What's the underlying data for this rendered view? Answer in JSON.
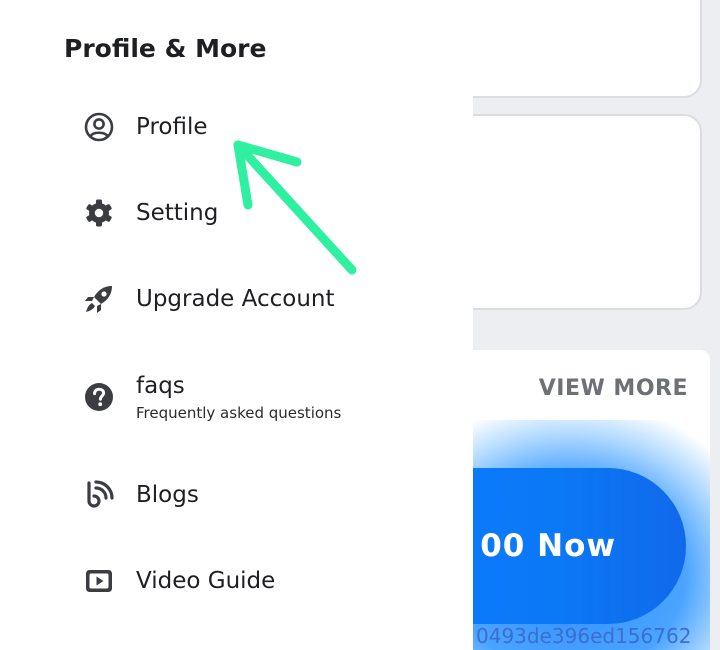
{
  "drawer": {
    "title": "Profile & More",
    "items": [
      {
        "label": "Profile",
        "icon": "user-circle-icon"
      },
      {
        "label": "Setting",
        "icon": "gear-icon"
      },
      {
        "label": "Upgrade Account",
        "icon": "rocket-icon"
      },
      {
        "label": "faqs",
        "sublabel": "Frequently asked questions",
        "icon": "question-circle-icon"
      },
      {
        "label": "Blogs",
        "icon": "blog-icon"
      },
      {
        "label": "Video Guide",
        "icon": "youtube-icon"
      }
    ]
  },
  "background": {
    "view_more": "VIEW MORE",
    "cta_label": "00 Now",
    "hash_text": "0493de396ed156762"
  },
  "colors": {
    "accent_blue": "#0a7cff",
    "arrow_green": "#2ef0a0",
    "text_dark": "#1e1f22"
  }
}
